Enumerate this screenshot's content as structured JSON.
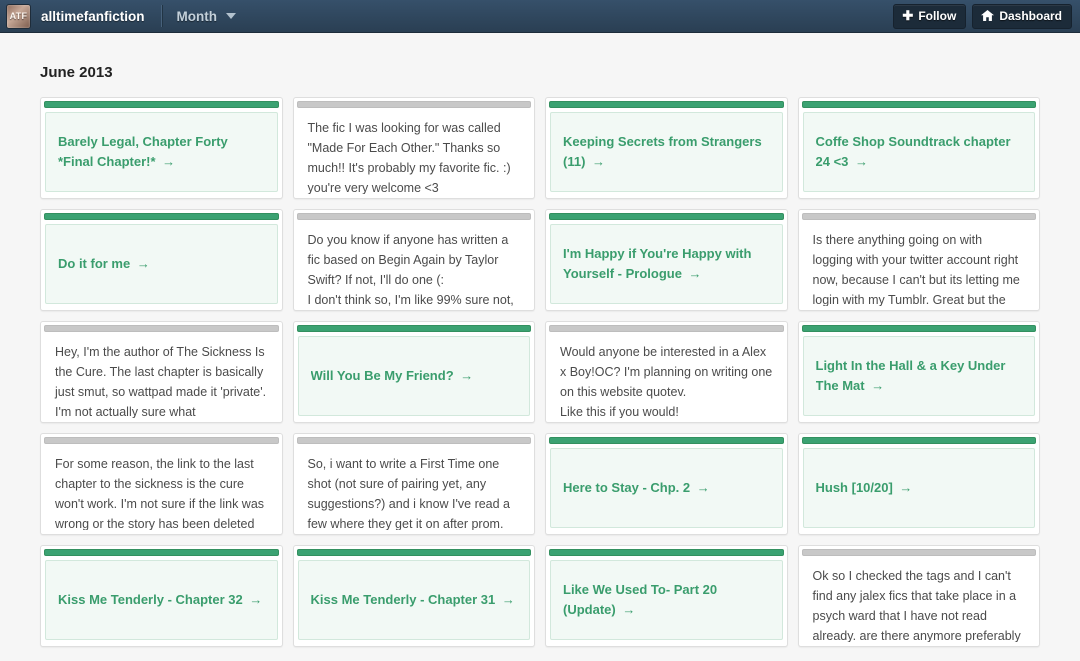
{
  "topbar": {
    "avatar_label": "ATF",
    "blog_name": "alltimefanfiction",
    "period_dropdown": "Month",
    "follow_label": "Follow",
    "dashboard_label": "Dashboard",
    "follow_icon": "plus-icon",
    "dashboard_icon": "house-icon",
    "caret_icon": "chevron-down-icon",
    "bar_color": "#2c4257"
  },
  "page": {
    "title": "June 2013",
    "accent_green": "#3ba272",
    "accent_gray": "#c8c8c8",
    "background": "#f6f6f6"
  },
  "cards": [
    {
      "type": "post",
      "text": "Barely Legal, Chapter Forty *Final Chapter!*",
      "arrow": "→"
    },
    {
      "type": "ask",
      "text": "The fic I was looking for was called \"Made For Each Other.\" Thanks so much!! It's probably my favorite fic. :)\nyou're very welcome <3"
    },
    {
      "type": "post",
      "text": "Keeping Secrets from Strangers (11)",
      "arrow": "→"
    },
    {
      "type": "post",
      "text": "Coffe Shop Soundtrack chapter 24 <3",
      "arrow": "→"
    },
    {
      "type": "post",
      "text": "Do it for me",
      "arrow": "→"
    },
    {
      "type": "ask",
      "text": "Do you know if anyone has written a fic based on Begin Again by Taylor Swift? If not, I'll do one (:\nI don't think so, I'm like 99% sure not,"
    },
    {
      "type": "post",
      "text": "I'm Happy if You're Happy with Yourself - Prologue",
      "arrow": "→"
    },
    {
      "type": "ask",
      "text": "Is there anything going on with logging with your twitter account right now, because I can't but its letting me login with my Tumblr. Great but the one I"
    },
    {
      "type": "ask",
      "text": "Hey, I'm the author of The Sickness Is the Cure. The last chapter is basically just smut, so wattpad made it 'private'. I'm not actually sure what"
    },
    {
      "type": "post",
      "text": "Will You Be My Friend?",
      "arrow": "→"
    },
    {
      "type": "ask",
      "text": "Would anyone be interested in a Alex x Boy!OC? I'm planning on writing one on this website quotev.\nLike this if you would!"
    },
    {
      "type": "post",
      "text": "Light In the Hall & a Key Under The Mat",
      "arrow": "→"
    },
    {
      "type": "ask",
      "text": "For some reason, the link to the last chapter to the sickness is the cure won't work. I'm not sure if the link was wrong or the story has been deleted or"
    },
    {
      "type": "ask",
      "text": "So, i want to write a First Time one shot (not sure of pairing yet, any suggestions?) and i know I've read a few where they get it on after prom."
    },
    {
      "type": "post",
      "text": "Here to Stay - Chp. 2",
      "arrow": "→"
    },
    {
      "type": "post",
      "text": "Hush [10/20]",
      "arrow": "→"
    },
    {
      "type": "post",
      "text": "Kiss Me Tenderly - Chapter 32",
      "arrow": "→"
    },
    {
      "type": "post",
      "text": "Kiss Me Tenderly - Chapter 31",
      "arrow": "→"
    },
    {
      "type": "post",
      "text": "Like We Used To- Part 20 (Update)",
      "arrow": "→"
    },
    {
      "type": "ask",
      "text": "Ok so I checked the tags and I can't find any jalex fics that take place in a psych ward that I have not read already. are there anymore preferably"
    }
  ]
}
